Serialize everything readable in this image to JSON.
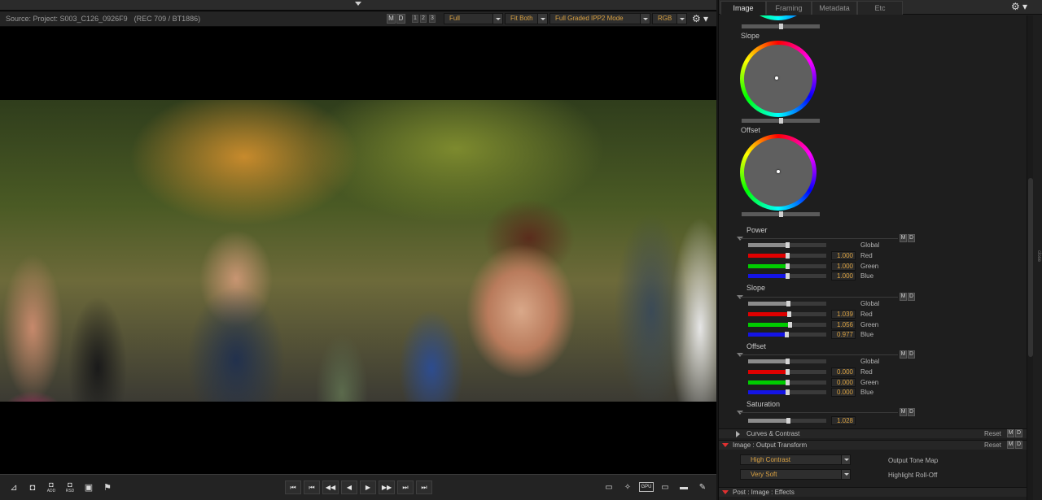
{
  "viewer": {
    "source": "Source: Project: S003_C126_0926F9",
    "color_space": "(REC 709 / BT1886)",
    "md": [
      "M",
      "D"
    ],
    "layouts": [
      "1",
      "2",
      "3"
    ],
    "quality": "Full",
    "fit": "Fit Both",
    "mode": "Full Graded IPP2 Mode",
    "channel": "RGB",
    "gear_icon": "gear-icon"
  },
  "bottom_bar": {
    "left_icons": [
      {
        "name": "clip-icon",
        "glyph": "⊿",
        "label": ""
      },
      {
        "name": "camera-icon",
        "glyph": "◘",
        "label": ""
      },
      {
        "name": "add-still-icon",
        "glyph": "◘",
        "label": "ADD"
      },
      {
        "name": "rsd-icon",
        "glyph": "◘",
        "label": "RSD"
      },
      {
        "name": "export-frame-icon",
        "glyph": "▣",
        "label": ""
      },
      {
        "name": "flag-icon",
        "glyph": "⚑",
        "label": ""
      }
    ],
    "transport": [
      "⏮",
      "⏮",
      "◀◀",
      "◀",
      "▶",
      "▶▶",
      "⏭",
      "⏭"
    ],
    "right_icons": [
      {
        "name": "monitor-icon",
        "glyph": "▭"
      },
      {
        "name": "magic-wand-icon",
        "glyph": "✧"
      },
      {
        "name": "gpu-icon",
        "glyph": "GPU"
      },
      {
        "name": "overlay-icon",
        "glyph": "▭"
      },
      {
        "name": "safe-area-icon",
        "glyph": "▬"
      },
      {
        "name": "ruler-icon",
        "glyph": "▭"
      },
      {
        "name": "annotate-icon",
        "glyph": "✎"
      }
    ]
  },
  "panel": {
    "tabs": [
      "Image",
      "Framing",
      "Metadata",
      "Etc"
    ],
    "active_tab": "Image",
    "wheels": [
      {
        "label": "Slope"
      },
      {
        "label": "Offset"
      }
    ],
    "groups": [
      {
        "label": "Power",
        "rows": [
          {
            "channel": "Global",
            "value": "",
            "pos": 0.5
          },
          {
            "channel": "Red",
            "value": "1.000",
            "pos": 0.5
          },
          {
            "channel": "Green",
            "value": "1.000",
            "pos": 0.5
          },
          {
            "channel": "Blue",
            "value": "1.000",
            "pos": 0.5
          }
        ]
      },
      {
        "label": "Slope",
        "rows": [
          {
            "channel": "Global",
            "value": "",
            "pos": 0.51
          },
          {
            "channel": "Red",
            "value": "1.039",
            "pos": 0.52
          },
          {
            "channel": "Green",
            "value": "1.056",
            "pos": 0.53
          },
          {
            "channel": "Blue",
            "value": "0.977",
            "pos": 0.49
          }
        ]
      },
      {
        "label": "Offset",
        "rows": [
          {
            "channel": "Global",
            "value": "",
            "pos": 0.5
          },
          {
            "channel": "Red",
            "value": "0.000",
            "pos": 0.5
          },
          {
            "channel": "Green",
            "value": "0.000",
            "pos": 0.5
          },
          {
            "channel": "Blue",
            "value": "0.000",
            "pos": 0.5
          }
        ]
      },
      {
        "label": "Saturation",
        "rows": [
          {
            "channel": "",
            "value": "1.028",
            "pos": 0.51
          }
        ]
      }
    ],
    "sections": {
      "curves": {
        "title": "Curves & Contrast",
        "reset": "Reset"
      },
      "output": {
        "title": "Image : Output Transform",
        "reset": "Reset"
      },
      "post": {
        "title": "Post : Image : Effects"
      }
    },
    "output": {
      "tone_map": {
        "value": "High Contrast",
        "label": "Output Tone Map"
      },
      "rolloff": {
        "value": "Very Soft",
        "label": "Highlight Roll-Off"
      }
    },
    "side_handle": "close"
  }
}
